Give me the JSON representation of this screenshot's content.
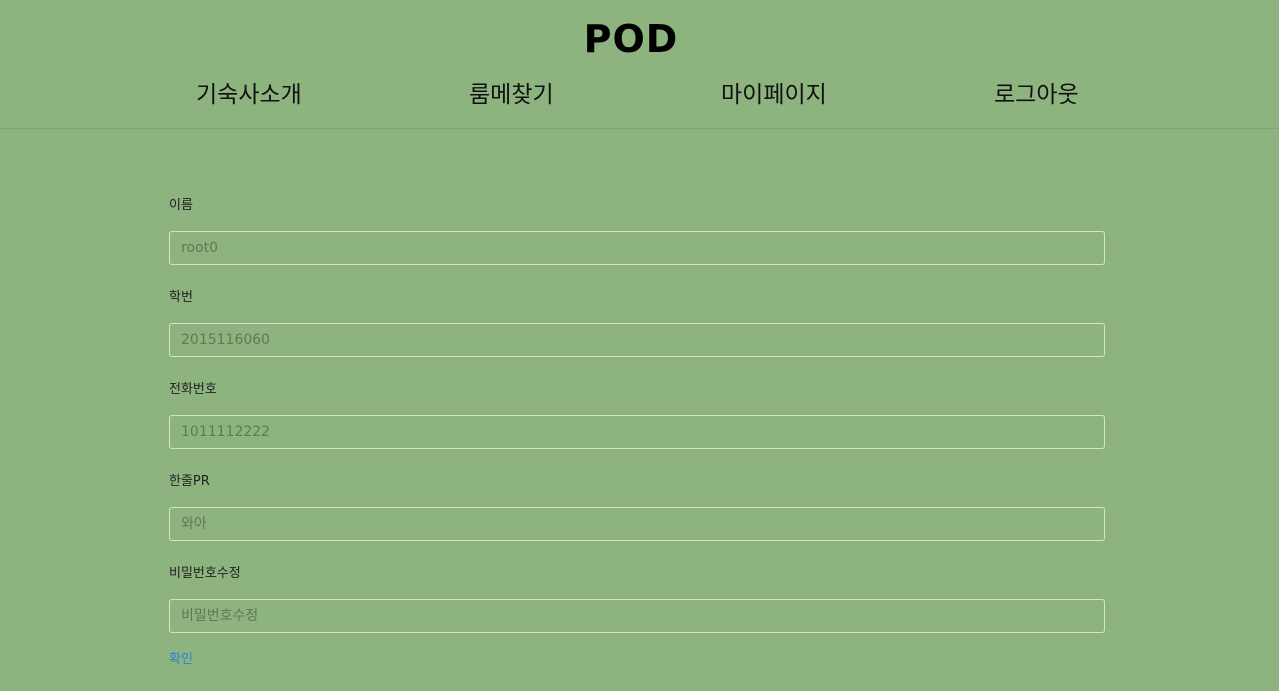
{
  "header": {
    "logo": "POD",
    "nav": [
      {
        "label": "기숙사소개"
      },
      {
        "label": "룸메찾기"
      },
      {
        "label": "마이페이지"
      },
      {
        "label": "로그아웃"
      }
    ]
  },
  "form": {
    "fields": [
      {
        "label": "이름",
        "placeholder": "root0"
      },
      {
        "label": "학번",
        "placeholder": "2015116060"
      },
      {
        "label": "전화번호",
        "placeholder": "1011112222"
      },
      {
        "label": "한줄PR",
        "placeholder": "와아"
      },
      {
        "label": "비밀번호수정",
        "placeholder": "비밀번호수정"
      }
    ],
    "confirm_label": "확인"
  },
  "colors": {
    "background": "#8db37f",
    "link": "#2f7ed8"
  }
}
